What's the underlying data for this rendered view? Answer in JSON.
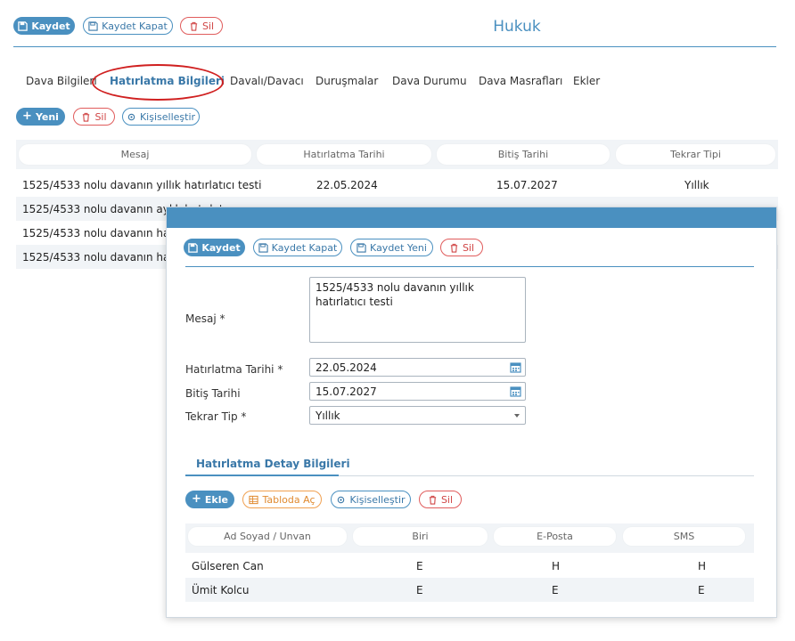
{
  "title": "Hukuk",
  "toolbar": {
    "save": "Kaydet",
    "save_close": "Kaydet Kapat",
    "delete": "Sil"
  },
  "tabs": [
    "Dava Bilgileri",
    "Hatırlatma Bilgileri",
    "Davalı/Davacı",
    "Duruşmalar",
    "Dava Durumu",
    "Dava Masrafları",
    "Ekler"
  ],
  "active_tab": "Hatırlatma Bilgileri",
  "list_toolbar": {
    "new": "Yeni",
    "delete": "Sil",
    "customize": "Kişiselleştir"
  },
  "reminder_table": {
    "headers": [
      "Mesaj",
      "Hatırlatma Tarihi",
      "Bitiş Tarihi",
      "Tekrar Tipi"
    ],
    "rows": [
      [
        "1525/4533 nolu davanın yıllık hatırlatıcı testi",
        "22.05.2024",
        "15.07.2027",
        "Yıllık"
      ],
      [
        "1525/4533 nolu davanın aylık hatırlatıcı",
        "",
        "",
        ""
      ],
      [
        "1525/4533 nolu davanın hatırlatıcı",
        "",
        "",
        ""
      ],
      [
        "1525/4533 nolu davanın haftalık",
        "",
        "",
        ""
      ]
    ]
  },
  "modal": {
    "toolbar": {
      "save": "Kaydet",
      "save_close": "Kaydet Kapat",
      "save_new": "Kaydet Yeni",
      "delete": "Sil"
    },
    "form": {
      "message_label": "Mesaj *",
      "message_value": "1525/4533 nolu davanın yıllık hatırlatıcı testi",
      "reminder_date_label": "Hatırlatma Tarihi *",
      "reminder_date_value": "22.05.2024",
      "end_date_label": "Bitiş Tarihi",
      "end_date_value": "15.07.2027",
      "repeat_type_label": "Tekrar Tip *",
      "repeat_type_value": "Yıllık"
    },
    "detail_tab": "Hatırlatma Detay Bilgileri",
    "detail_toolbar": {
      "add": "Ekle",
      "open_table": "Tabloda Aç",
      "customize": "Kişiselleştir",
      "delete": "Sil"
    },
    "detail_table": {
      "headers": [
        "Ad Soyad / Unvan",
        "Biri",
        "E-Posta",
        "SMS"
      ],
      "rows": [
        [
          "Gülseren Can",
          "E",
          "H",
          "H"
        ],
        [
          "Ümit Kolcu",
          "E",
          "E",
          "E"
        ]
      ]
    }
  },
  "colors": {
    "accent": "#4a90c0",
    "danger": "#e05c5c",
    "warning": "#f0a050",
    "highlight_ellipse": "#d02020"
  }
}
